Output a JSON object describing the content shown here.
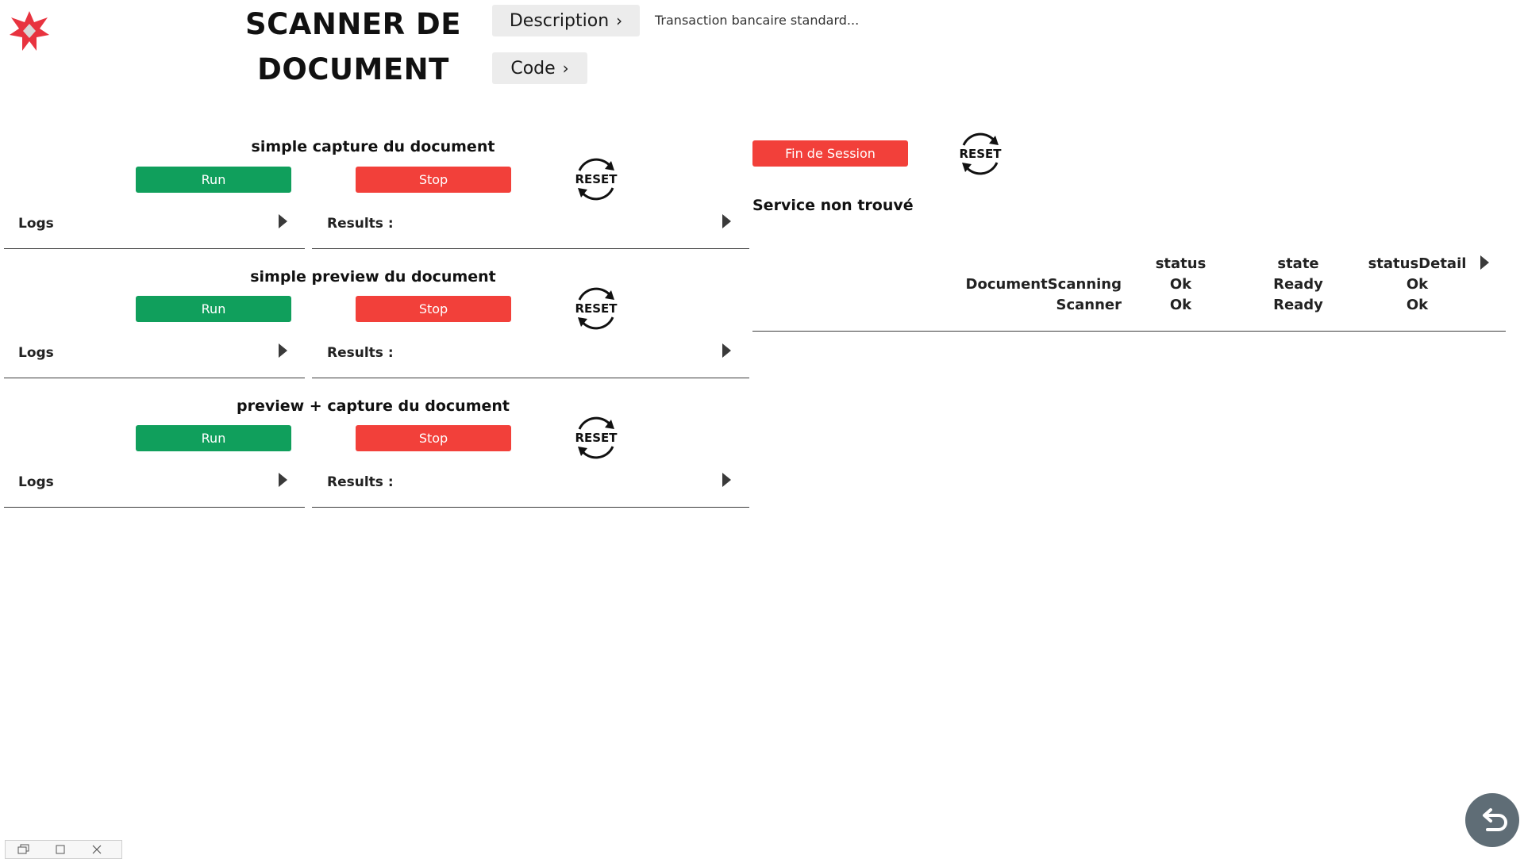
{
  "header": {
    "title": "SCANNER DE DOCUMENT",
    "description_button": "Description",
    "description_chevron": "›",
    "description_text": "Transaction bancaire standard...",
    "code_button": "Code",
    "code_chevron": "›"
  },
  "sections": [
    {
      "title": "simple capture du document",
      "run": "Run",
      "stop": "Stop",
      "reset": "RESET",
      "logs": "Logs",
      "results": "Results :"
    },
    {
      "title": "simple preview du document",
      "run": "Run",
      "stop": "Stop",
      "reset": "RESET",
      "logs": "Logs",
      "results": "Results :"
    },
    {
      "title": "preview + capture du document",
      "run": "Run",
      "stop": "Stop",
      "reset": "RESET",
      "logs": "Logs",
      "results": "Results :"
    }
  ],
  "session": {
    "end_button": "Fin de Session",
    "reset": "RESET",
    "message": "Service non trouvé"
  },
  "status_table": {
    "columns": [
      "status",
      "state",
      "statusDetail"
    ],
    "rows": [
      {
        "name": "DocumentScanning",
        "status": "Ok",
        "state": "Ready",
        "statusDetail": "Ok"
      },
      {
        "name": "Scanner",
        "status": "Ok",
        "state": "Ready",
        "statusDetail": "Ok"
      }
    ]
  },
  "colors": {
    "run": "#109f5c",
    "stop": "#f2403a",
    "logo": "#e8333f",
    "back_button": "#5f6d76"
  },
  "icons": {
    "logo": "star-logo-icon",
    "reset": "reset-arrows-icon",
    "expand": "triangle-right-icon",
    "back": "return-arrow-icon"
  }
}
